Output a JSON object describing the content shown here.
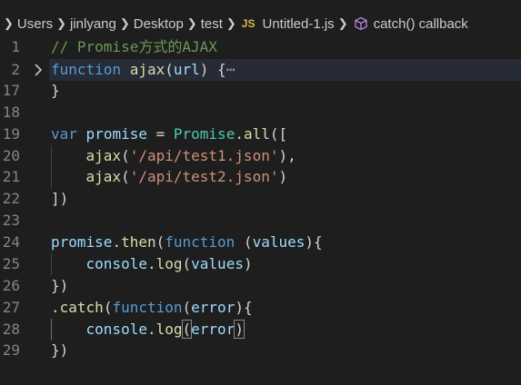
{
  "breadcrumb": {
    "segments": [
      "Users",
      "jinlyang",
      "Desktop",
      "test"
    ],
    "file_badge": "JS",
    "file_name": "Untitled-1.js",
    "symbol": "catch() callback"
  },
  "gutter": {
    "line_numbers": [
      "1",
      "2",
      "17",
      "18",
      "19",
      "20",
      "21",
      "22",
      "23",
      "24",
      "25",
      "26",
      "27",
      "28",
      "29"
    ]
  },
  "code": {
    "l1": {
      "comment": "// Promise方式的AJAX"
    },
    "l2": {
      "kw": "function",
      "fn": "ajax",
      "open": "(",
      "param": "url",
      "close": ") {",
      "ellipsis": "⋯"
    },
    "l17": {
      "text": "}"
    },
    "l19": {
      "kw": "var",
      "var": "promise",
      "eq": " = ",
      "cls": "Promise",
      "dot": ".",
      "fn": "all",
      "open": "(["
    },
    "l20": {
      "fn": "ajax",
      "open": "(",
      "str": "'/api/test1.json'",
      "close": "),"
    },
    "l21": {
      "fn": "ajax",
      "open": "(",
      "str": "'/api/test2.json'",
      "close": ")"
    },
    "l22": {
      "text": "])"
    },
    "l24": {
      "var": "promise",
      "dot": ".",
      "fn": "then",
      "open": "(",
      "kw": "function",
      "open2": " (",
      "param": "values",
      "close": "){"
    },
    "l25": {
      "var": "console",
      "dot": ".",
      "fn": "log",
      "open": "(",
      "arg": "values",
      "close": ")"
    },
    "l26": {
      "text": "})"
    },
    "l27": {
      "dot": ".",
      "fn": "catch",
      "open": "(",
      "kw": "function",
      "open2": "(",
      "param": "error",
      "close": "){"
    },
    "l28": {
      "var": "console",
      "dot": ".",
      "fn": "log",
      "open": "(",
      "arg": "error",
      "close": ")"
    },
    "l29": {
      "text": "})"
    }
  },
  "colors": {
    "background": "#1e1e1e",
    "comment": "#6a9955",
    "keyword": "#569cd6",
    "function": "#dcdcaa",
    "variable": "#9cdcfe",
    "class": "#4ec9b0",
    "string": "#ce9178",
    "js_badge": "#d7ba48",
    "symbol_icon": "#b180d7"
  },
  "icons": {
    "breadcrumb_separator": "chevron-right-icon",
    "symbol": "method-cube-icon",
    "fold": "fold-chevron-icon"
  }
}
